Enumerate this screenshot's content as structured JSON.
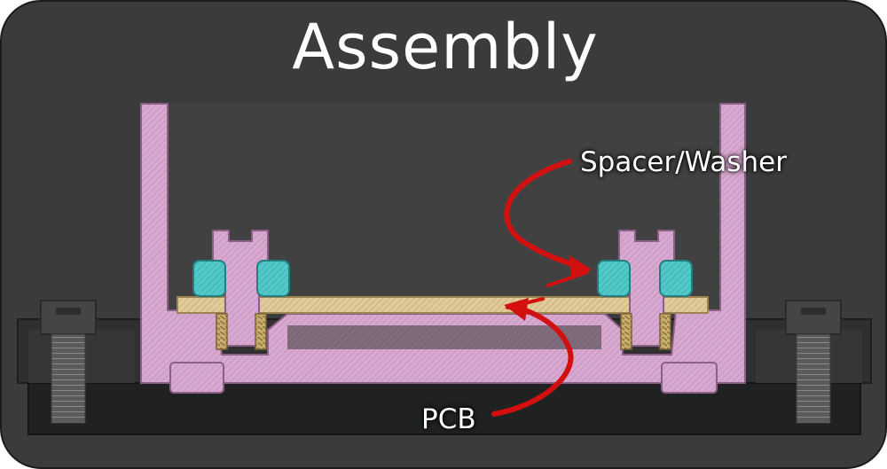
{
  "title": "Assembly",
  "callouts": {
    "spacer_washer": "Spacer/Washer",
    "pcb": "PCB"
  },
  "colors": {
    "background": "#3b3b3b",
    "housing": "#d7a6cf",
    "pcb": "#dcc595",
    "washer": "#4ec6c7",
    "arrow": "#d31010"
  }
}
